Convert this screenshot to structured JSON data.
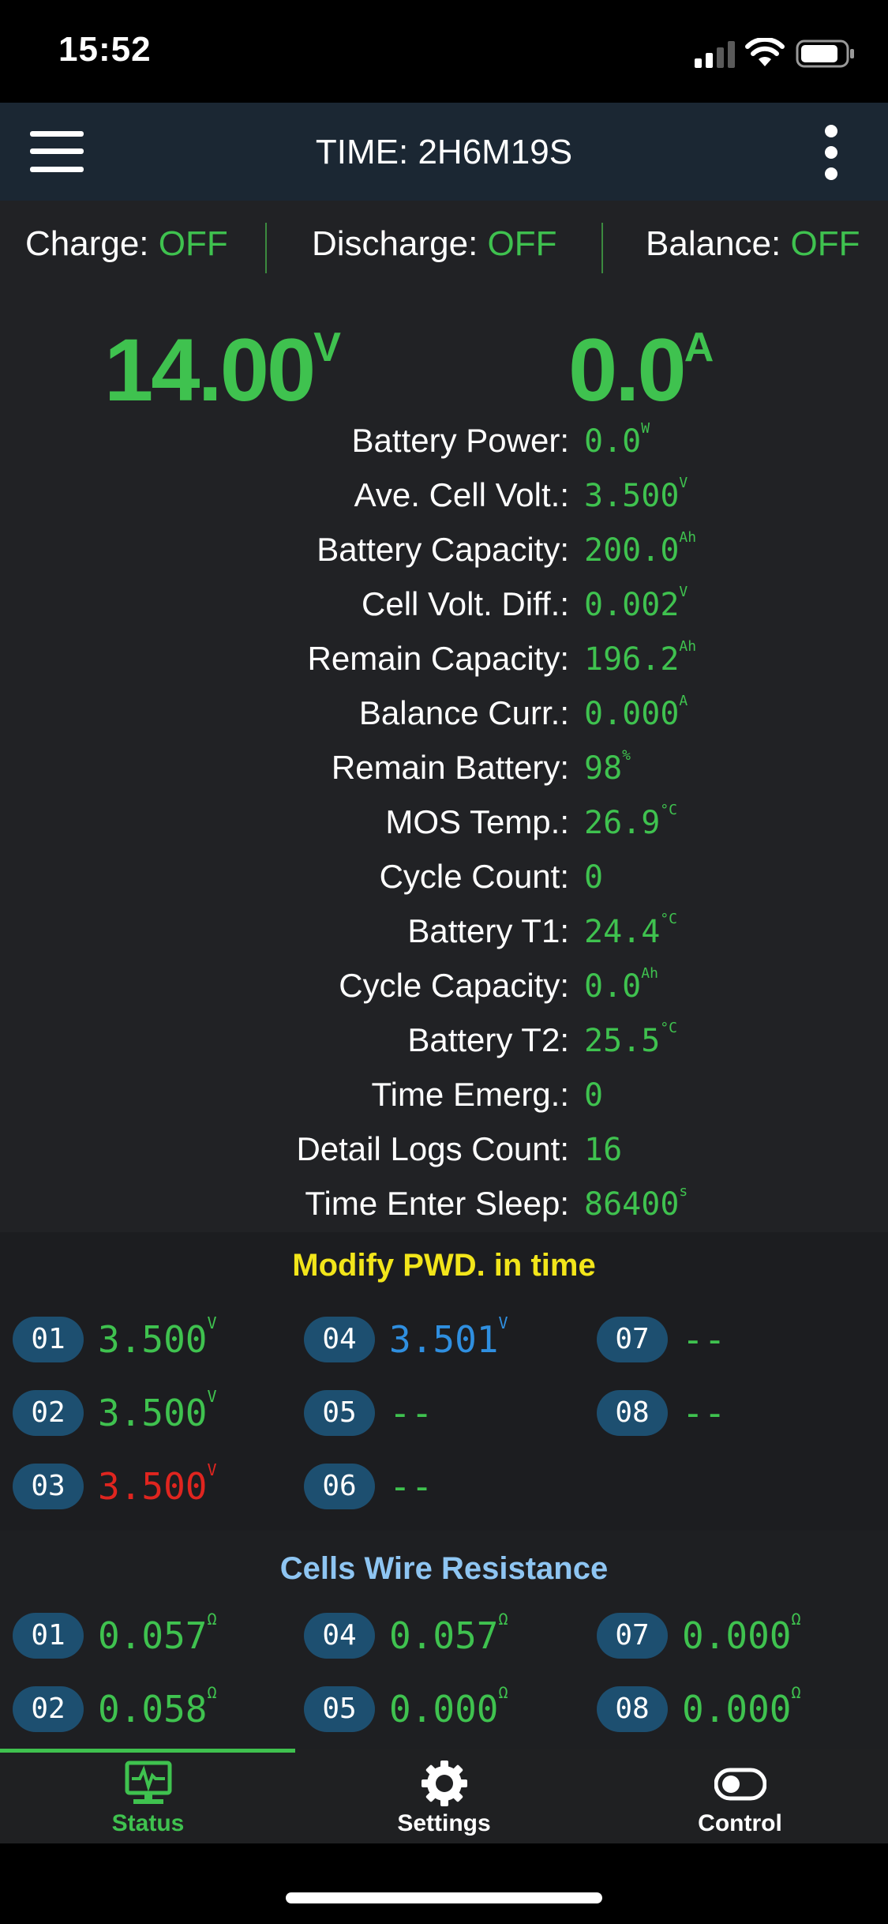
{
  "status_bar": {
    "time": "15:52"
  },
  "header": {
    "title": "TIME: 2H6M19S"
  },
  "switches": [
    {
      "label": "Charge: ",
      "state": "OFF"
    },
    {
      "label": "Discharge: ",
      "state": "OFF"
    },
    {
      "label": "Balance: ",
      "state": "OFF"
    }
  ],
  "readout": {
    "voltage": "14.00",
    "voltage_unit": "V",
    "current": "0.0",
    "current_unit": "A"
  },
  "stats": [
    {
      "label": "Battery Power:",
      "value": "0.0",
      "unit": "W"
    },
    {
      "label": "Ave. Cell Volt.:",
      "value": "3.500",
      "unit": "V"
    },
    {
      "label": "Battery Capacity:",
      "value": "200.0",
      "unit": "Ah"
    },
    {
      "label": "Cell Volt. Diff.:",
      "value": "0.002",
      "unit": "V"
    },
    {
      "label": "Remain Capacity:",
      "value": "196.2",
      "unit": "Ah"
    },
    {
      "label": "Balance Curr.:",
      "value": "0.000",
      "unit": "A"
    },
    {
      "label": "Remain Battery:",
      "value": "98",
      "unit": "%"
    },
    {
      "label": "MOS Temp.:",
      "value": "26.9",
      "unit": "°C"
    },
    {
      "label": "Cycle Count:",
      "value": "0",
      "unit": ""
    },
    {
      "label": "Battery T1:",
      "value": "24.4",
      "unit": "°C"
    },
    {
      "label": "Cycle Capacity:",
      "value": "0.0",
      "unit": "Ah"
    },
    {
      "label": "Battery T2:",
      "value": "25.5",
      "unit": "°C"
    },
    {
      "label": "Time Emerg.:",
      "value": "0",
      "unit": ""
    },
    {
      "label": "Detail Logs Count:",
      "value": "16",
      "unit": ""
    },
    {
      "label": "Time Enter Sleep:",
      "value": "86400",
      "unit": "s"
    }
  ],
  "cell_voltages": {
    "title": "Modify PWD. in time",
    "title_color": "#f2e51a",
    "cells": [
      {
        "id": "01",
        "value": "3.500",
        "unit": "V",
        "color": "#3fc24f"
      },
      {
        "id": "02",
        "value": "3.500",
        "unit": "V",
        "color": "#3fc24f"
      },
      {
        "id": "03",
        "value": "3.500",
        "unit": "V",
        "color": "#e0251f"
      },
      {
        "id": "04",
        "value": "3.501",
        "unit": "V",
        "color": "#2f8fe0"
      },
      {
        "id": "05",
        "value": "--",
        "unit": "",
        "color": "#3fc24f"
      },
      {
        "id": "06",
        "value": "--",
        "unit": "",
        "color": "#3fc24f"
      },
      {
        "id": "07",
        "value": "--",
        "unit": "",
        "color": "#3fc24f"
      },
      {
        "id": "08",
        "value": "--",
        "unit": "",
        "color": "#3fc24f"
      }
    ]
  },
  "wire_resistance": {
    "title": "Cells Wire Resistance",
    "title_color": "#8ec5f2",
    "cells": [
      {
        "id": "01",
        "value": "0.057",
        "unit": "Ω",
        "color": "#3fc24f"
      },
      {
        "id": "02",
        "value": "0.058",
        "unit": "Ω",
        "color": "#3fc24f"
      },
      {
        "id": "04",
        "value": "0.057",
        "unit": "Ω",
        "color": "#3fc24f"
      },
      {
        "id": "05",
        "value": "0.000",
        "unit": "Ω",
        "color": "#3fc24f"
      },
      {
        "id": "07",
        "value": "0.000",
        "unit": "Ω",
        "color": "#3fc24f"
      },
      {
        "id": "08",
        "value": "0.000",
        "unit": "Ω",
        "color": "#3fc24f"
      }
    ]
  },
  "tabs": [
    {
      "label": "Status",
      "icon": "monitor-pulse-icon",
      "active": true
    },
    {
      "label": "Settings",
      "icon": "gear-icon",
      "active": false
    },
    {
      "label": "Control",
      "icon": "toggle-icon",
      "active": false
    }
  ],
  "colors": {
    "accent": "#3fc24f",
    "header_bg": "#1b2733",
    "badge_bg": "#1d4f70"
  }
}
